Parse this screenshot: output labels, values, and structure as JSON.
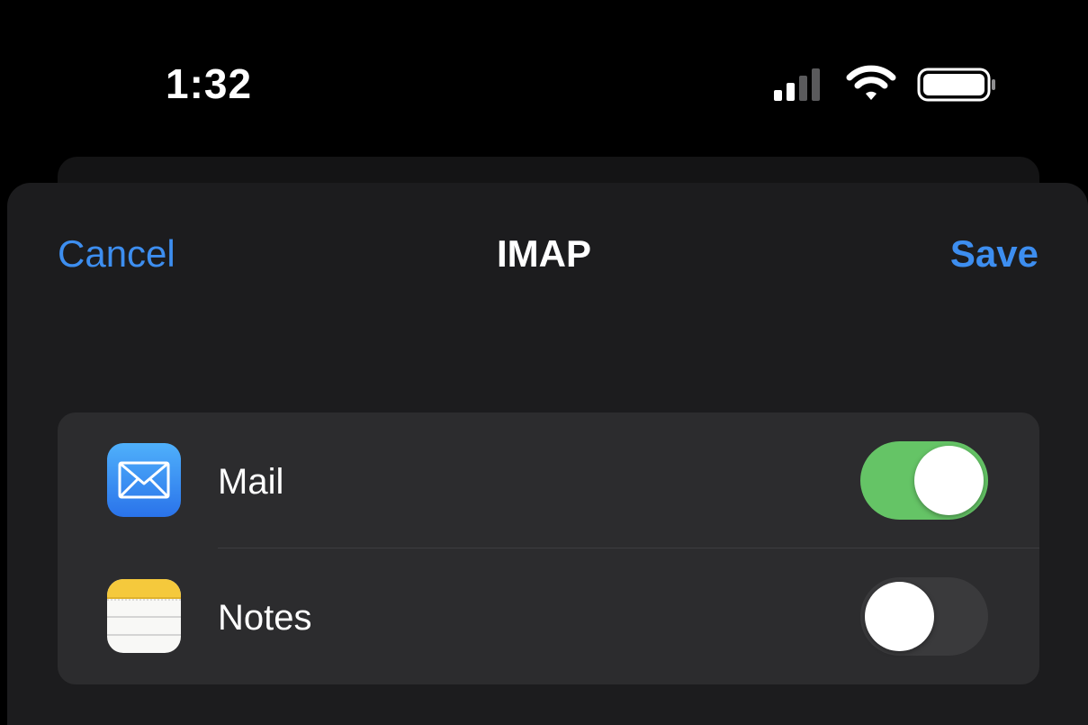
{
  "status_bar": {
    "time": "1:32",
    "icons": [
      "cellular-signal-icon",
      "wifi-icon",
      "battery-icon"
    ]
  },
  "nav": {
    "cancel_label": "Cancel",
    "title": "IMAP",
    "save_label": "Save"
  },
  "settings": {
    "items": [
      {
        "label": "Mail",
        "icon": "mail-app-icon",
        "enabled": true
      },
      {
        "label": "Notes",
        "icon": "notes-app-icon",
        "enabled": false
      }
    ]
  },
  "colors": {
    "accent": "#3d8ef0",
    "toggle_on": "#65c466",
    "toggle_off": "#3a3a3c",
    "background": "#000000",
    "sheet": "#1c1c1e",
    "group": "#2c2c2e"
  }
}
